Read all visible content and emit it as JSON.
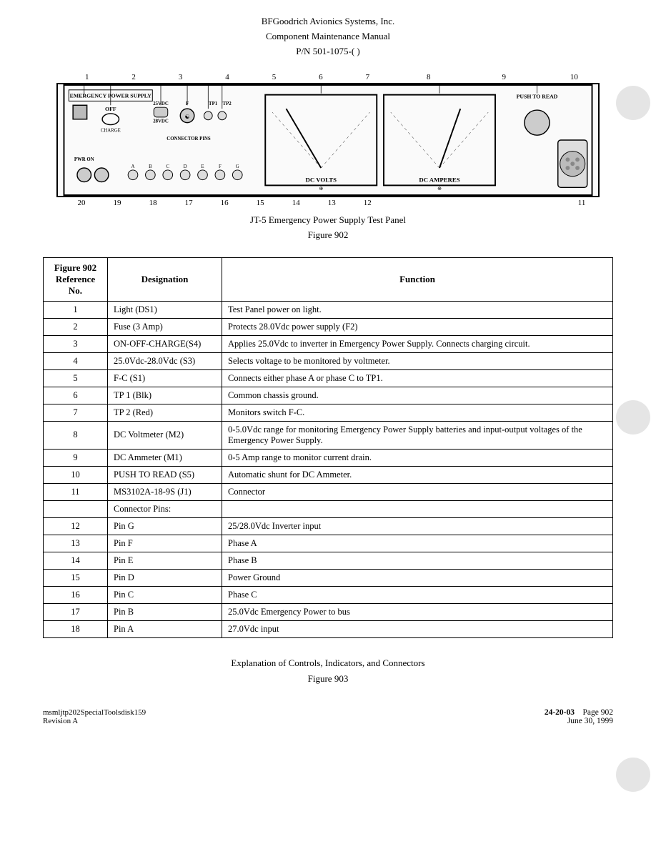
{
  "header": {
    "company": "BFGoodrich Avionics Systems, Inc.",
    "manual": "Component Maintenance Manual",
    "partno": "P/N 501-1075-( )"
  },
  "diagram": {
    "title_line1": "JT-5 Emergency Power Supply Test Panel",
    "title_line2": "Figure 902",
    "top_numbers": [
      "1",
      "2",
      "3",
      "4",
      "5",
      "6",
      "7",
      "8",
      "9",
      "10"
    ],
    "bottom_numbers": [
      "20",
      "19",
      "18",
      "17",
      "16",
      "15",
      "14",
      "13",
      "12",
      "11"
    ],
    "labels": {
      "emergency_power_supply": "EMERGENCY POWER SUPPLY",
      "pwr_on": "PWR ON",
      "off": "OFF",
      "charge": "CHARGE",
      "25vdc": "25VDC",
      "28vdc": "28VDC",
      "connector_pins": "CONNECTOR PINS",
      "tp1": "TP1",
      "tp2": "TP2",
      "f": "F",
      "dc_volts": "DC VOLTS",
      "dc_amperes": "DC AMPERES",
      "push_to_read": "PUSH TO READ"
    }
  },
  "table": {
    "col_headers": {
      "ref": "Figure 902\nReference\nNo.",
      "designation": "Designation",
      "function": "Function"
    },
    "rows": [
      {
        "ref": "1",
        "designation": "Light (DS1)",
        "function": "Test Panel power on light."
      },
      {
        "ref": "2",
        "designation": "Fuse (3 Amp)",
        "function": "Protects 28.0Vdc power supply (F2)"
      },
      {
        "ref": "3",
        "designation": "ON-OFF-CHARGE(S4)",
        "function": "Applies 25.0Vdc to inverter in Emergency Power Supply.  Connects charging circuit."
      },
      {
        "ref": "4",
        "designation": "25.0Vdc-28.0Vdc (S3)",
        "function": "Selects voltage to be monitored by voltmeter."
      },
      {
        "ref": "5",
        "designation": "F-C (S1)",
        "function": "Connects either phase A or phase C to TP1."
      },
      {
        "ref": "6",
        "designation": "TP 1 (Blk)",
        "function": "Common chassis ground."
      },
      {
        "ref": "7",
        "designation": "TP 2 (Red)",
        "function": "Monitors switch F-C."
      },
      {
        "ref": "8",
        "designation": "DC Voltmeter (M2)",
        "function": "0-5.0Vdc range for monitoring Emergency Power Supply batteries and input-output voltages of the Emergency Power Supply."
      },
      {
        "ref": "9",
        "designation": "DC Ammeter (M1)",
        "function": "0-5 Amp range to monitor current drain."
      },
      {
        "ref": "10",
        "designation": "PUSH TO READ (S5)",
        "function": "Automatic shunt for DC Ammeter."
      },
      {
        "ref": "11",
        "designation": "MS3102A-18-9S (J1)",
        "function": "Connector"
      },
      {
        "ref": "",
        "designation": "Connector Pins:",
        "function": ""
      },
      {
        "ref": "12",
        "designation": "Pin G",
        "function": "25/28.0Vdc Inverter input"
      },
      {
        "ref": "13",
        "designation": "Pin F",
        "function": "Phase A"
      },
      {
        "ref": "14",
        "designation": "Pin E",
        "function": "Phase B"
      },
      {
        "ref": "15",
        "designation": "Pin D",
        "function": "Power Ground"
      },
      {
        "ref": "16",
        "designation": "Pin C",
        "function": "Phase C"
      },
      {
        "ref": "17",
        "designation": "Pin B",
        "function": "25.0Vdc Emergency Power to bus"
      },
      {
        "ref": "18",
        "designation": "Pin A",
        "function": "27.0Vdc input"
      }
    ]
  },
  "section_caption": {
    "line1": "Explanation of Controls, Indicators, and Connectors",
    "line2": "Figure 903"
  },
  "footer": {
    "filename": "msmljtp202SpecialToolsdisk159",
    "revision": "Revision A",
    "doc_ref": "24-20-03",
    "page": "Page 902",
    "date": "June 30, 1999"
  }
}
